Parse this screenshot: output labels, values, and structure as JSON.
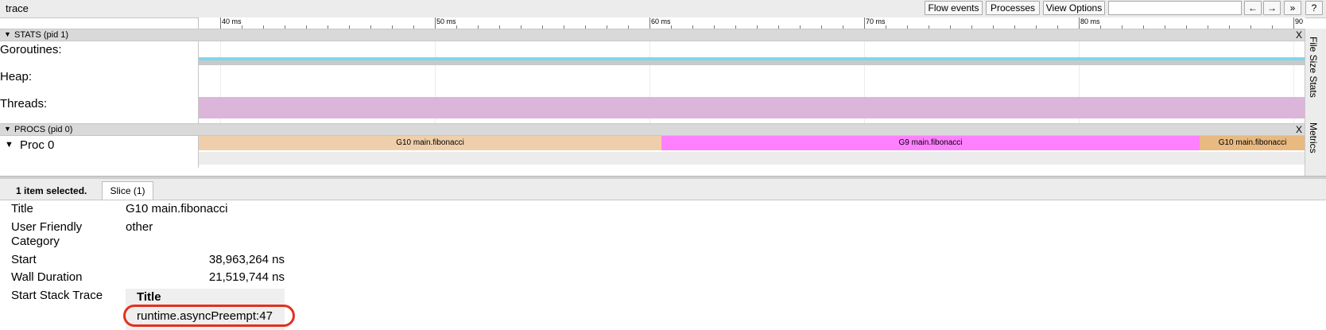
{
  "toolbar": {
    "title": "trace",
    "buttons": {
      "flow_events": "Flow events",
      "processes": "Processes",
      "view_options": "View Options",
      "prev": "←",
      "next": "→",
      "more": "»",
      "help": "?"
    },
    "search_value": ""
  },
  "ruler": {
    "labels": [
      "40 ms",
      "50 ms",
      "60 ms",
      "70 ms",
      "80 ms",
      "90"
    ]
  },
  "stats_section": {
    "header": "STATS (pid 1)",
    "close": "X",
    "rows": [
      "Goroutines:",
      "Heap:",
      "Threads:"
    ]
  },
  "procs_section": {
    "header": "PROCS (pid 0)",
    "close": "X",
    "proc_label": "Proc 0",
    "slices": [
      {
        "label": "G10 main.fibonacci",
        "color": "#efcfab"
      },
      {
        "label": "G9 main.fibonacci",
        "color": "#ff80ff"
      },
      {
        "label": "G10 main.fibonacci",
        "color": "#e8b981"
      }
    ]
  },
  "side_tabs": [
    "File Size Stats",
    "Metrics"
  ],
  "colors": {
    "goroutines_cyan": "#7fd6ee",
    "goroutines_gray": "#c9c9c9",
    "threads_lilac": "#dcb5da",
    "highlight_red": "#e2311f"
  },
  "analysis": {
    "selection_text": "1 item selected.",
    "tab_label": "Slice (1)",
    "fields": {
      "title_key": "Title",
      "title_value": "G10 main.fibonacci",
      "category_key_line1": "User Friendly",
      "category_key_line2": "Category",
      "category_value": "other",
      "start_key": "Start",
      "start_value": "38,963,264 ns",
      "duration_key": "Wall Duration",
      "duration_value": "21,519,744 ns",
      "stack_key": "Start Stack Trace"
    },
    "stack_table": {
      "header": "Title",
      "frames": [
        "runtime.asyncPreempt:47"
      ]
    }
  }
}
